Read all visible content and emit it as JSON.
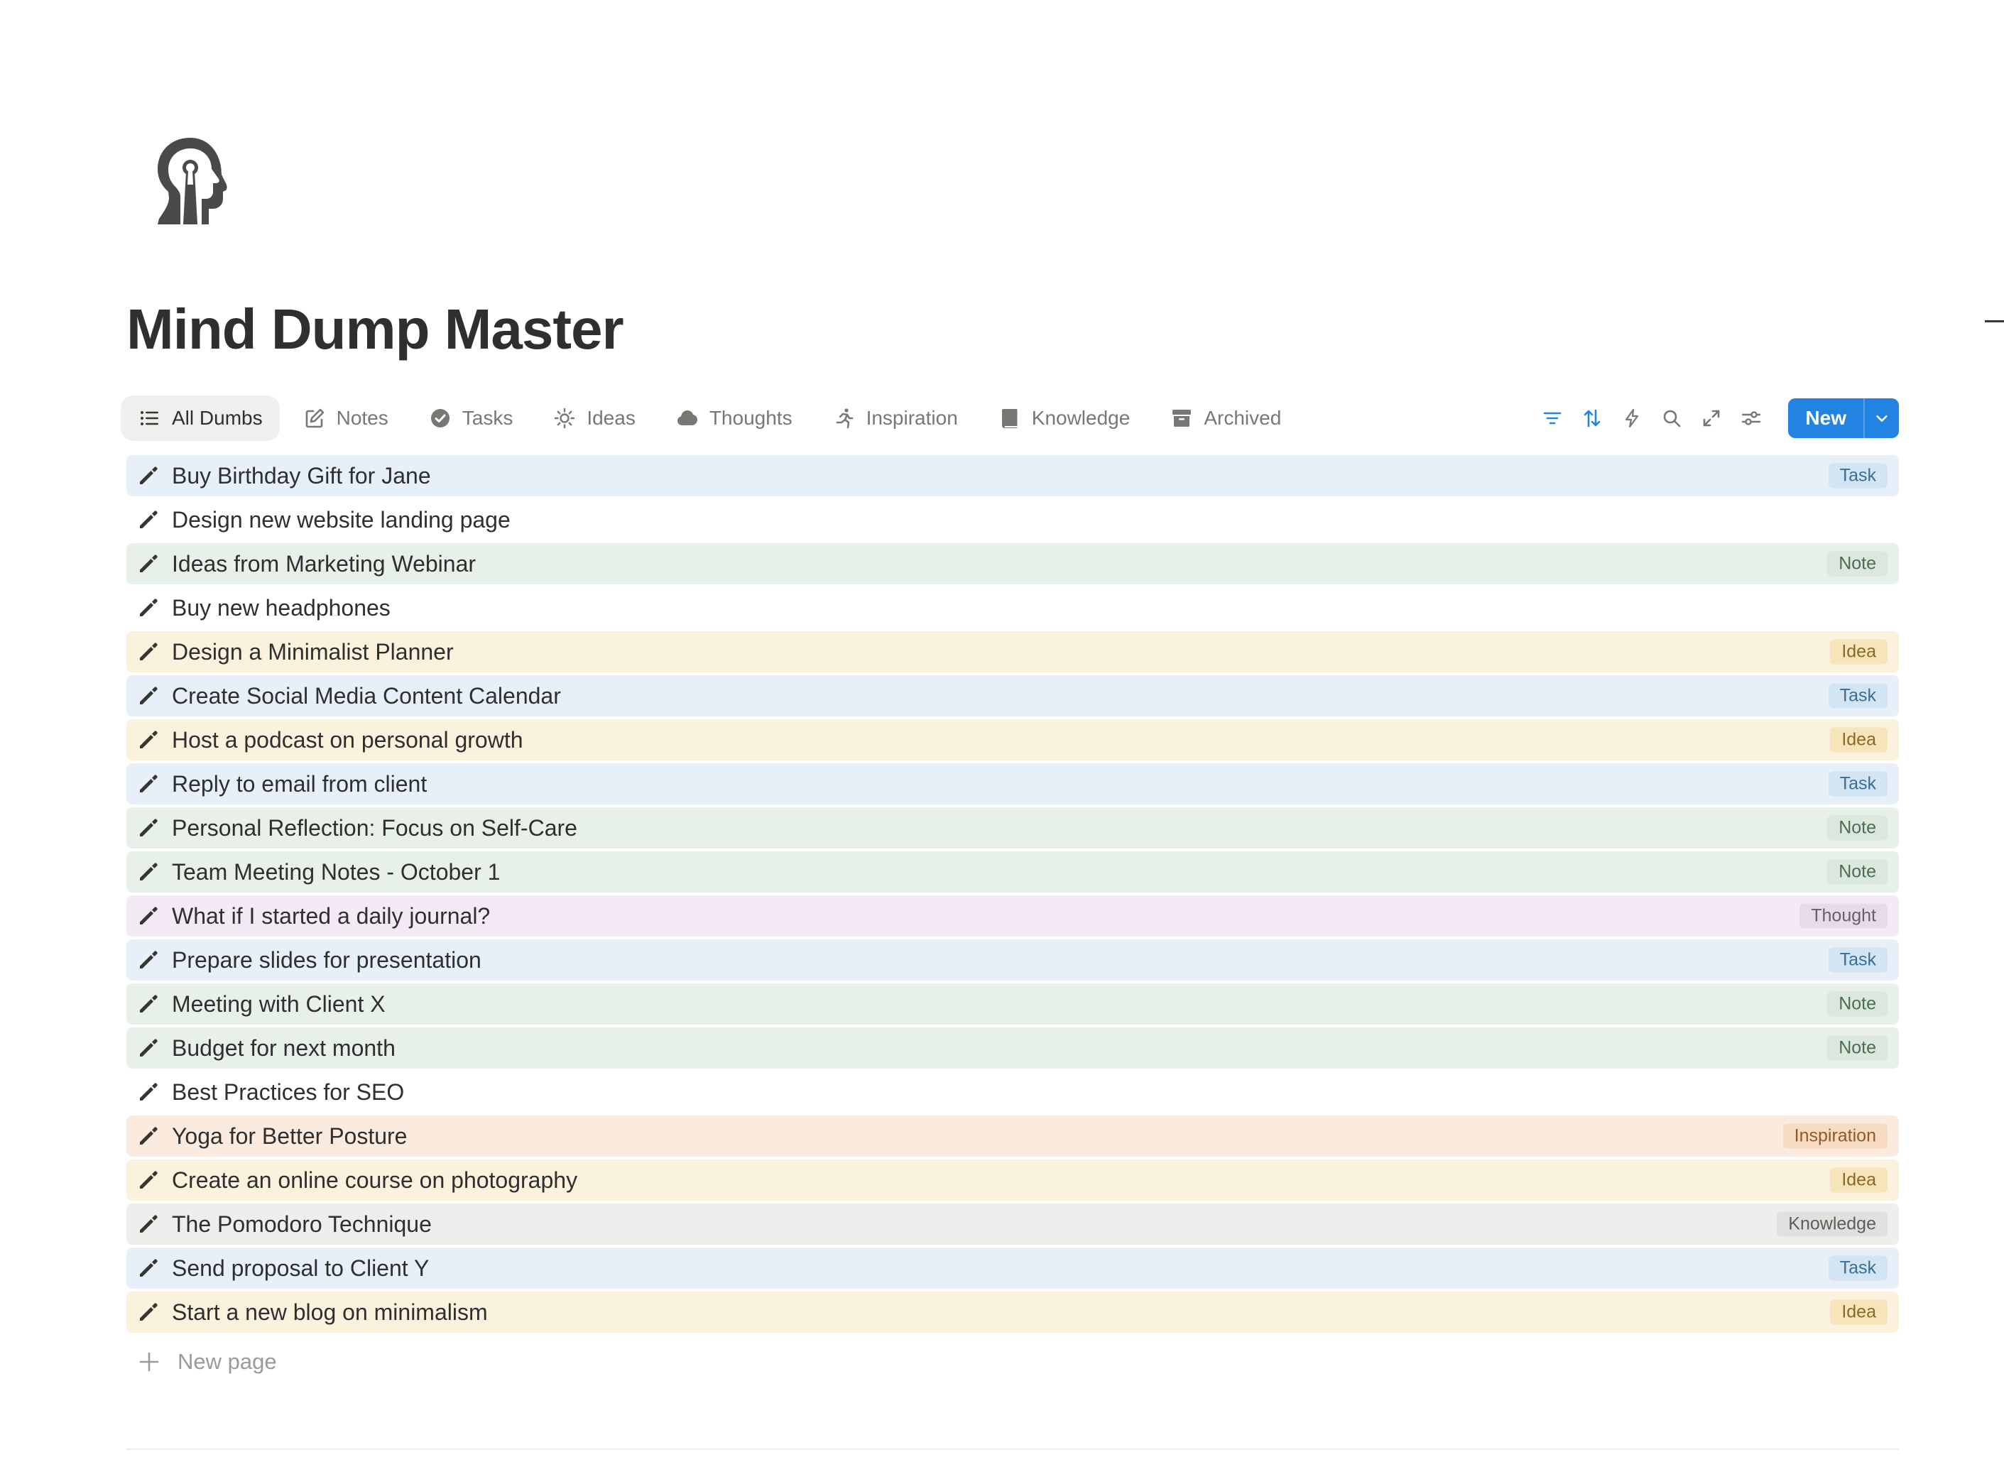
{
  "page": {
    "title": "Mind Dump Master",
    "icon": "head-with-keyhole-icon"
  },
  "tabs": [
    {
      "label": "All Dumbs",
      "icon": "list-icon",
      "active": true
    },
    {
      "label": "Notes",
      "icon": "edit-note-icon",
      "active": false
    },
    {
      "label": "Tasks",
      "icon": "check-circle-icon",
      "active": false
    },
    {
      "label": "Ideas",
      "icon": "sun-icon",
      "active": false
    },
    {
      "label": "Thoughts",
      "icon": "cloud-icon",
      "active": false
    },
    {
      "label": "Inspiration",
      "icon": "running-person-icon",
      "active": false
    },
    {
      "label": "Knowledge",
      "icon": "book-icon",
      "active": false
    },
    {
      "label": "Archived",
      "icon": "archive-box-icon",
      "active": false
    }
  ],
  "toolbar": {
    "actions": [
      {
        "name": "filter",
        "icon": "filter-icon"
      },
      {
        "name": "sort",
        "icon": "sort-arrows-icon"
      },
      {
        "name": "automation",
        "icon": "lightning-icon"
      },
      {
        "name": "search",
        "icon": "search-icon"
      },
      {
        "name": "expand",
        "icon": "expand-arrows-icon"
      },
      {
        "name": "settings",
        "icon": "sliders-icon"
      }
    ],
    "new_label": "New",
    "accent_color": "#2383e2"
  },
  "tag_styles": {
    "Task": {
      "row_bg": "#e7f0f8",
      "tag_bg": "#d3e5f3",
      "tag_fg": "#3b6e96"
    },
    "Note": {
      "row_bg": "#e8f0ea",
      "tag_bg": "#dbe8de",
      "tag_fg": "#4e6b55"
    },
    "Idea": {
      "row_bg": "#faf2dc",
      "tag_bg": "#f6e4bb",
      "tag_fg": "#8a6a22"
    },
    "Thought": {
      "row_bg": "#f3eaf6",
      "tag_bg": "#e6dbe9",
      "tag_fg": "#6b5a70"
    },
    "Inspiration": {
      "row_bg": "#fbebde",
      "tag_bg": "#f7dcc3",
      "tag_fg": "#8d5a2e"
    },
    "Knowledge": {
      "row_bg": "#efeeec",
      "tag_bg": "#e1e0de",
      "tag_fg": "#5e5d5a"
    },
    "": {
      "row_bg": "#ffffff",
      "tag_bg": "transparent",
      "tag_fg": "#787774"
    }
  },
  "rows": [
    {
      "title": "Buy Birthday Gift for Jane",
      "tag": "Task",
      "icon": "pencil-icon"
    },
    {
      "title": "Design new website landing page",
      "tag": "",
      "icon": "pencil-icon"
    },
    {
      "title": "Ideas from Marketing Webinar",
      "tag": "Note",
      "icon": "pencil-icon"
    },
    {
      "title": "Buy new headphones",
      "tag": "",
      "icon": "pencil-icon"
    },
    {
      "title": "Design a Minimalist Planner",
      "tag": "Idea",
      "icon": "pencil-icon"
    },
    {
      "title": "Create Social Media Content Calendar",
      "tag": "Task",
      "icon": "pencil-icon"
    },
    {
      "title": "Host a podcast on personal growth",
      "tag": "Idea",
      "icon": "pencil-icon"
    },
    {
      "title": "Reply to email from client",
      "tag": "Task",
      "icon": "pencil-icon"
    },
    {
      "title": "Personal Reflection: Focus on Self-Care",
      "tag": "Note",
      "icon": "pencil-icon"
    },
    {
      "title": "Team Meeting Notes - October 1",
      "tag": "Note",
      "icon": "pencil-icon"
    },
    {
      "title": "What if I started a daily journal?",
      "tag": "Thought",
      "icon": "pencil-icon"
    },
    {
      "title": "Prepare slides for presentation",
      "tag": "Task",
      "icon": "pencil-icon"
    },
    {
      "title": "Meeting with Client X",
      "tag": "Note",
      "icon": "pencil-icon"
    },
    {
      "title": "Budget for next month",
      "tag": "Note",
      "icon": "pencil-icon"
    },
    {
      "title": "Best Practices for SEO",
      "tag": "",
      "icon": "pencil-icon"
    },
    {
      "title": "Yoga for Better Posture",
      "tag": "Inspiration",
      "icon": "pencil-icon"
    },
    {
      "title": "Create an online course on photography",
      "tag": "Idea",
      "icon": "pencil-icon"
    },
    {
      "title": "The Pomodoro Technique",
      "tag": "Knowledge",
      "icon": "pencil-icon"
    },
    {
      "title": "Send proposal to Client Y",
      "tag": "Task",
      "icon": "pencil-icon"
    },
    {
      "title": "Start a new blog on minimalism",
      "tag": "Idea",
      "icon": "pencil-icon"
    }
  ],
  "footer": {
    "new_page_label": "New page"
  }
}
